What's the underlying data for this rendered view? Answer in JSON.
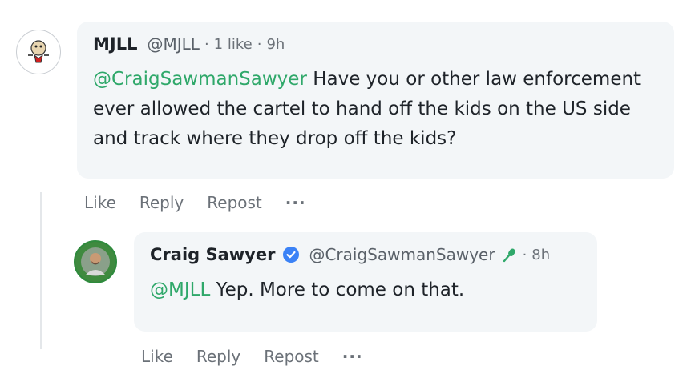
{
  "comment": {
    "author_name": "MJLL",
    "author_handle": "@MJLL",
    "likes": "1 like",
    "time": "9h",
    "mention": "@CraigSawmanSawyer",
    "text": " Have you or other law enforcement ever allowed the cartel to hand off the kids on the US side and track where they drop off the kids?",
    "actions": {
      "like": "Like",
      "reply": "Reply",
      "repost": "Repost",
      "more": "···"
    },
    "avatar_icon": "cartoon-character-avatar"
  },
  "reply": {
    "author_name": "Craig Sawyer",
    "author_handle": "@CraigSawmanSawyer",
    "time": "8h",
    "mention": "@MJLL",
    "text": " Yep. More to come on that.",
    "verified_icon": "verified-badge-icon",
    "status_icon": "microphone-icon",
    "actions": {
      "like": "Like",
      "reply": "Reply",
      "repost": "Repost",
      "more": "···"
    },
    "avatar_icon": "profile-photo-avatar"
  },
  "colors": {
    "mention": "#2fa86a",
    "bubble_bg": "#f3f6f8",
    "verified": "#3b82f6",
    "meta_text": "#6b7178"
  }
}
